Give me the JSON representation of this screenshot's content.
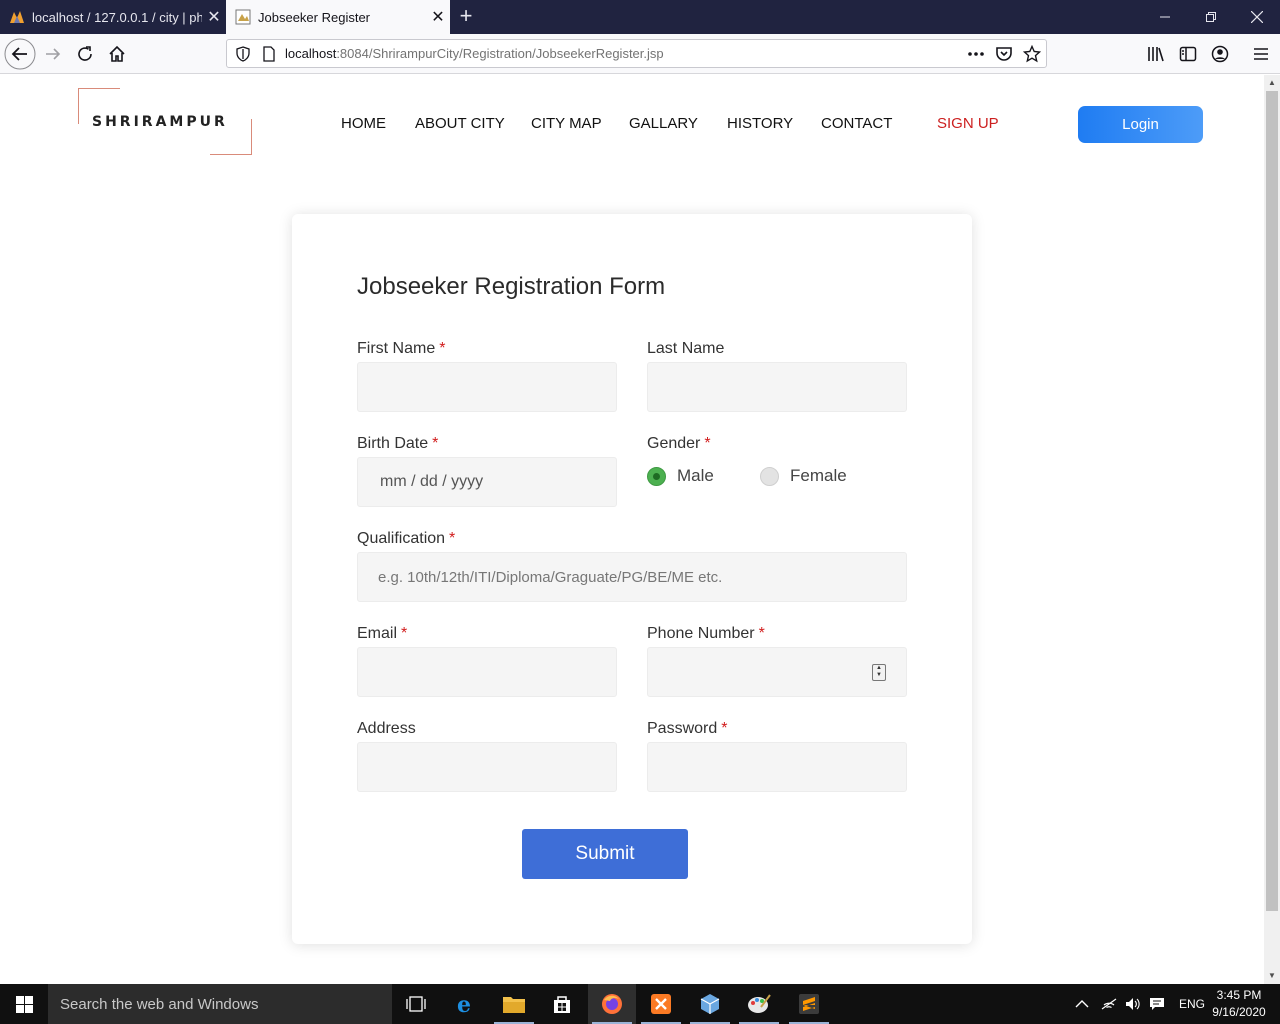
{
  "browser": {
    "tabs": [
      {
        "title": "localhost / 127.0.0.1 / city | php",
        "active": false
      },
      {
        "title": "Jobseeker Register",
        "active": true
      }
    ],
    "url_host": "localhost",
    "url_path": ":8084/ShrirampurCity/Registration/JobseekerRegister.jsp"
  },
  "site": {
    "logo": "SHRIRAMPUR",
    "nav": [
      "HOME",
      "ABOUT CITY",
      "CITY MAP",
      "GALLARY",
      "HISTORY",
      "CONTACT",
      "SIGN UP"
    ],
    "login": "Login"
  },
  "form": {
    "title": "Jobseeker Registration Form",
    "first_name": {
      "label": "First Name",
      "required": "*",
      "value": ""
    },
    "last_name": {
      "label": "Last Name",
      "value": ""
    },
    "birth_date": {
      "label": "Birth Date",
      "required": "*",
      "placeholder": "mm / dd / yyyy"
    },
    "gender": {
      "label": "Gender",
      "required": "*",
      "options": [
        "Male",
        "Female"
      ],
      "selected": "Male"
    },
    "qualification": {
      "label": "Qualification",
      "required": "*",
      "placeholder": "e.g. 10th/12th/ITI/Diploma/Graguate/PG/BE/ME etc."
    },
    "email": {
      "label": "Email",
      "required": "*",
      "value": ""
    },
    "phone": {
      "label": "Phone Number",
      "required": "*",
      "value": ""
    },
    "address": {
      "label": "Address",
      "value": ""
    },
    "password": {
      "label": "Password",
      "required": "*",
      "value": ""
    },
    "submit": "Submit"
  },
  "taskbar": {
    "search_placeholder": "Search the web and Windows",
    "language": "ENG",
    "time": "3:45 PM",
    "date": "9/16/2020"
  },
  "colors": {
    "accent": "#3e6ed7",
    "login_gradient_start": "#1f7cf2",
    "signup": "#cc1f1f",
    "required": "#d11b1b",
    "radio_selected": "#4cb050"
  }
}
